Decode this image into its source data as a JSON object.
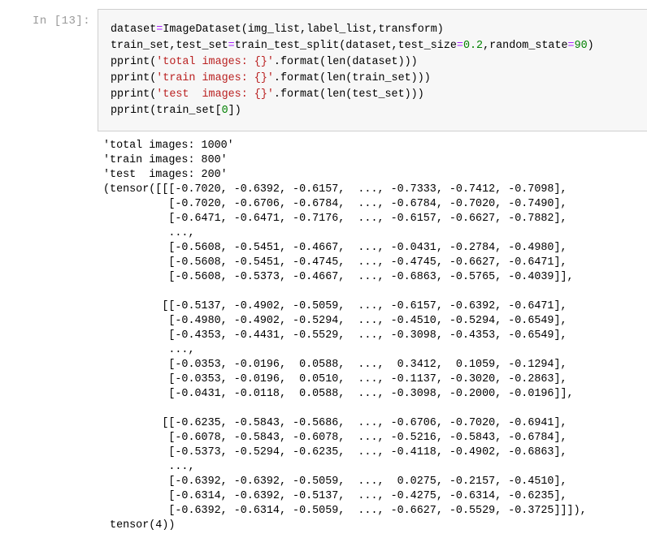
{
  "cell": {
    "prompt": "In  [13]:",
    "input_lines": [
      [
        {
          "t": "dataset",
          "c": "plain"
        },
        {
          "t": "=",
          "c": "op"
        },
        {
          "t": "ImageDataset(img_list,label_list,transform)",
          "c": "plain"
        }
      ],
      [
        {
          "t": "train_set,test_set",
          "c": "plain"
        },
        {
          "t": "=",
          "c": "op"
        },
        {
          "t": "train_test_split(dataset,test_size",
          "c": "plain"
        },
        {
          "t": "=",
          "c": "op"
        },
        {
          "t": "0.2",
          "c": "num"
        },
        {
          "t": ",random_state",
          "c": "plain"
        },
        {
          "t": "=",
          "c": "op"
        },
        {
          "t": "90",
          "c": "num"
        },
        {
          "t": ")",
          "c": "plain"
        }
      ],
      [
        {
          "t": "pprint(",
          "c": "plain"
        },
        {
          "t": "'total images: {}'",
          "c": "str"
        },
        {
          "t": ".format(len(dataset)))",
          "c": "plain"
        }
      ],
      [
        {
          "t": "pprint(",
          "c": "plain"
        },
        {
          "t": "'train images: {}'",
          "c": "str"
        },
        {
          "t": ".format(len(train_set)))",
          "c": "plain"
        }
      ],
      [
        {
          "t": "pprint(",
          "c": "plain"
        },
        {
          "t": "'test  images: {}'",
          "c": "str"
        },
        {
          "t": ".format(len(test_set)))",
          "c": "plain"
        }
      ],
      [
        {
          "t": "pprint(train_set[",
          "c": "plain"
        },
        {
          "t": "0",
          "c": "num"
        },
        {
          "t": "])",
          "c": "plain"
        }
      ]
    ],
    "output_lines": [
      "'total images: 1000'",
      "'train images: 800'",
      "'test  images: 200'",
      "(tensor([[[-0.7020, -0.6392, -0.6157,  ..., -0.7333, -0.7412, -0.7098],",
      "          [-0.7020, -0.6706, -0.6784,  ..., -0.6784, -0.7020, -0.7490],",
      "          [-0.6471, -0.6471, -0.7176,  ..., -0.6157, -0.6627, -0.7882],",
      "          ...,",
      "          [-0.5608, -0.5451, -0.4667,  ..., -0.0431, -0.2784, -0.4980],",
      "          [-0.5608, -0.5451, -0.4745,  ..., -0.4745, -0.6627, -0.6471],",
      "          [-0.5608, -0.5373, -0.4667,  ..., -0.6863, -0.5765, -0.4039]],",
      "",
      "         [[-0.5137, -0.4902, -0.5059,  ..., -0.6157, -0.6392, -0.6471],",
      "          [-0.4980, -0.4902, -0.5294,  ..., -0.4510, -0.5294, -0.6549],",
      "          [-0.4353, -0.4431, -0.5529,  ..., -0.3098, -0.4353, -0.6549],",
      "          ...,",
      "          [-0.0353, -0.0196,  0.0588,  ...,  0.3412,  0.1059, -0.1294],",
      "          [-0.0353, -0.0196,  0.0510,  ..., -0.1137, -0.3020, -0.2863],",
      "          [-0.0431, -0.0118,  0.0588,  ..., -0.3098, -0.2000, -0.0196]],",
      "",
      "         [[-0.6235, -0.5843, -0.5686,  ..., -0.6706, -0.7020, -0.6941],",
      "          [-0.6078, -0.5843, -0.6078,  ..., -0.5216, -0.5843, -0.6784],",
      "          [-0.5373, -0.5294, -0.6235,  ..., -0.4118, -0.4902, -0.6863],",
      "          ...,",
      "          [-0.6392, -0.6392, -0.5059,  ...,  0.0275, -0.2157, -0.4510],",
      "          [-0.6314, -0.6392, -0.5137,  ..., -0.4275, -0.6314, -0.6235],",
      "          [-0.6392, -0.6314, -0.5059,  ..., -0.6627, -0.5529, -0.3725]]]),",
      " tensor(4))"
    ]
  },
  "colors": {
    "prompt": "#9a9a9a",
    "input_background": "#f7f7f7",
    "input_border": "#cfcfcf",
    "string": "#ba2121",
    "number": "#008000",
    "operator": "#aa22ff",
    "text": "#000000"
  }
}
